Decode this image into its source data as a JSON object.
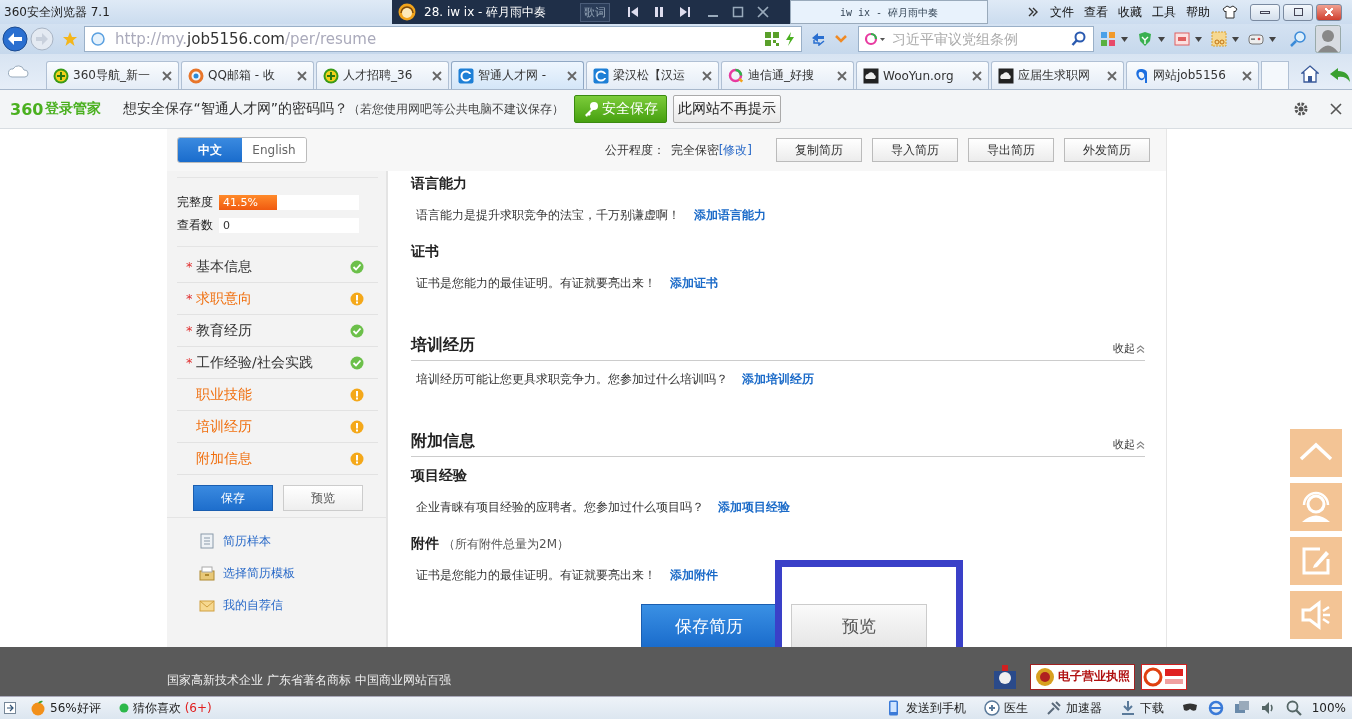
{
  "window": {
    "title": "360安全浏览器 7.1"
  },
  "player": {
    "track": "28. iw ix - 碎月雨中奏",
    "lyrics_button": "歌词",
    "tab": "iw ix - 碎月雨中奏"
  },
  "menus": [
    "文件",
    "查看",
    "收藏",
    "工具",
    "帮助"
  ],
  "address": {
    "prefix": "http://my.",
    "domain": "job5156.com",
    "path": "/per/resume"
  },
  "search": {
    "placeholder": "习近平审议党组条例"
  },
  "tabs": [
    {
      "label": "360导航_新一",
      "kind": "plus",
      "selected": false
    },
    {
      "label": "QQ邮箱 - 收",
      "kind": "ring",
      "selected": false
    },
    {
      "label": "人才招聘_36",
      "kind": "plus",
      "selected": false
    },
    {
      "label": "智通人才网 -",
      "kind": "c",
      "selected": true
    },
    {
      "label": "梁汉松【汉运",
      "kind": "c",
      "selected": false
    },
    {
      "label": "迪信通_好搜",
      "kind": "q",
      "selected": false
    },
    {
      "label": "WooYun.org",
      "kind": "cloud",
      "selected": false
    },
    {
      "label": "应届生求职网",
      "kind": "cloud",
      "selected": false
    },
    {
      "label": "网站job5156",
      "kind": "a",
      "selected": false
    }
  ],
  "password_bar": {
    "brand_number": "360",
    "brand_text": "登录管家",
    "message": "想安全保存“智通人才网”的密码吗？",
    "hint": "（若您使用网吧等公共电脑不建议保存）",
    "save_button": "安全保存",
    "dismiss_button": "此网站不再提示"
  },
  "languages": [
    {
      "label": "中文",
      "selected": true
    },
    {
      "label": "English",
      "selected": false
    }
  ],
  "privacy": {
    "label": "公开程度：",
    "value": "完全保密",
    "edit_link": "[修改]"
  },
  "toolbar_buttons": [
    "复制简历",
    "导入简历",
    "导出简历",
    "外发简历"
  ],
  "completeness": {
    "label": "完整度",
    "level": 0.415,
    "reading": "41.5%"
  },
  "views": {
    "label": "查看数",
    "value": "0"
  },
  "sections_nav": [
    {
      "marker": "*",
      "label": "基本信息",
      "complete": true
    },
    {
      "marker": "*",
      "label": "求职意向",
      "complete": false
    },
    {
      "marker": "*",
      "label": "教育经历",
      "complete": true
    },
    {
      "marker": "*",
      "label": "工作经验/社会实践",
      "complete": true
    },
    {
      "label": "职业技能",
      "complete": false
    },
    {
      "label": "培训经历",
      "complete": false
    },
    {
      "label": "附加信息",
      "complete": false
    }
  ],
  "side_buttons": [
    {
      "label": "保存",
      "primary": true
    },
    {
      "label": "预览",
      "primary": false
    }
  ],
  "side_links": [
    {
      "label": "简历样本",
      "kind": "doc"
    },
    {
      "label": "选择简历模板",
      "kind": "box"
    },
    {
      "label": "我的自荐信",
      "kind": "mail"
    }
  ],
  "blocks": [
    {
      "kind": "item",
      "title": "语言能力",
      "text": "语言能力是提升求职竞争的法宝，千万别谦虚啊！",
      "link": "添加语言能力"
    },
    {
      "kind": "item",
      "title": "证书",
      "text": "证书是您能力的最佳证明。有证就要亮出来！",
      "link": "添加证书"
    },
    {
      "kind": "section",
      "title": "培训经历",
      "toggle": "收起",
      "text": "培训经历可能让您更具求职竞争力。您参加过什么培训吗？",
      "link": "添加培训经历"
    },
    {
      "kind": "section",
      "title": "附加信息",
      "toggle": "收起"
    },
    {
      "kind": "item",
      "title": "项目经验",
      "text": "企业青睐有项目经验的应聘者。您参加过什么项目吗？",
      "link": "添加项目经验"
    },
    {
      "kind": "item",
      "title": "附件",
      "note": "（所有附件总量为2M）",
      "text": "证书是您能力的最佳证明。有证就要亮出来！",
      "link": "添加附件"
    }
  ],
  "actions": [
    {
      "label": "保存简历",
      "primary": true
    },
    {
      "label": "预览",
      "primary": false
    }
  ],
  "footer": {
    "text": "国家高新技术企业 广东省著名商标 中国商业网站百强",
    "license_badge": "电子营业执照"
  },
  "status_bar": {
    "rating": "56%好评",
    "recommend": "猜你喜欢",
    "recommend_count": "(6+)",
    "right": [
      "发送到手机",
      "医生",
      "加速器",
      "下载"
    ],
    "zoom": "100%"
  }
}
